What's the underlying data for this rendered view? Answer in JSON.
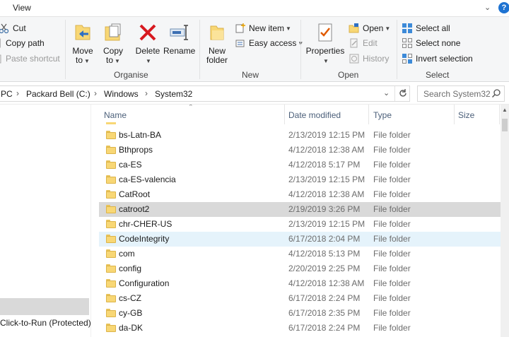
{
  "ribbon_tabs": {
    "view": "View"
  },
  "clipboard": {
    "cut": "Cut",
    "copy_path": "Copy path",
    "paste_shortcut": "Paste shortcut"
  },
  "organise": {
    "move_to": "Move",
    "move_to_2": "to",
    "copy_to": "Copy",
    "copy_to_2": "to",
    "delete": "Delete",
    "rename": "Rename",
    "label": "Organise"
  },
  "new_group": {
    "new_folder": "New",
    "new_folder_2": "folder",
    "new_item": "New item",
    "easy_access": "Easy access",
    "label": "New"
  },
  "open_group": {
    "properties": "Properties",
    "open": "Open",
    "edit": "Edit",
    "history": "History",
    "label": "Open"
  },
  "select_group": {
    "select_all": "Select all",
    "select_none": "Select none",
    "invert_selection": "Invert selection",
    "label": "Select"
  },
  "address": {
    "crumbs": [
      "PC",
      "Packard Bell (C:)",
      "Windows",
      "System32"
    ],
    "search_placeholder": "Search System32"
  },
  "nav_pane": {
    "visible_item": "Click-to-Run (Protected)"
  },
  "columns": {
    "name": "Name",
    "date_modified": "Date modified",
    "type": "Type",
    "size": "Size"
  },
  "files": [
    {
      "name": "bs-Latn-BA",
      "date": "2/13/2019 12:15 PM",
      "type": "File folder"
    },
    {
      "name": "Bthprops",
      "date": "4/12/2018 12:38 AM",
      "type": "File folder"
    },
    {
      "name": "ca-ES",
      "date": "4/12/2018 5:17 PM",
      "type": "File folder"
    },
    {
      "name": "ca-ES-valencia",
      "date": "2/13/2019 12:15 PM",
      "type": "File folder"
    },
    {
      "name": "CatRoot",
      "date": "4/12/2018 12:38 AM",
      "type": "File folder"
    },
    {
      "name": "catroot2",
      "date": "2/19/2019 3:26 PM",
      "type": "File folder",
      "state": "selected"
    },
    {
      "name": "chr-CHER-US",
      "date": "2/13/2019 12:15 PM",
      "type": "File folder"
    },
    {
      "name": "CodeIntegrity",
      "date": "6/17/2018 2:04 PM",
      "type": "File folder",
      "state": "hover"
    },
    {
      "name": "com",
      "date": "4/12/2018 5:13 PM",
      "type": "File folder"
    },
    {
      "name": "config",
      "date": "2/20/2019 2:25 PM",
      "type": "File folder"
    },
    {
      "name": "Configuration",
      "date": "4/12/2018 12:38 AM",
      "type": "File folder"
    },
    {
      "name": "cs-CZ",
      "date": "6/17/2018 2:24 PM",
      "type": "File folder"
    },
    {
      "name": "cy-GB",
      "date": "6/17/2018 2:35 PM",
      "type": "File folder"
    },
    {
      "name": "da-DK",
      "date": "6/17/2018 2:24 PM",
      "type": "File folder"
    }
  ],
  "colors": {
    "accent": "#1e73d2",
    "selected_row": "#d9d9d9",
    "hover_row": "#e5f3fb",
    "folder": "#f8d775",
    "header_text": "#4c607a"
  }
}
